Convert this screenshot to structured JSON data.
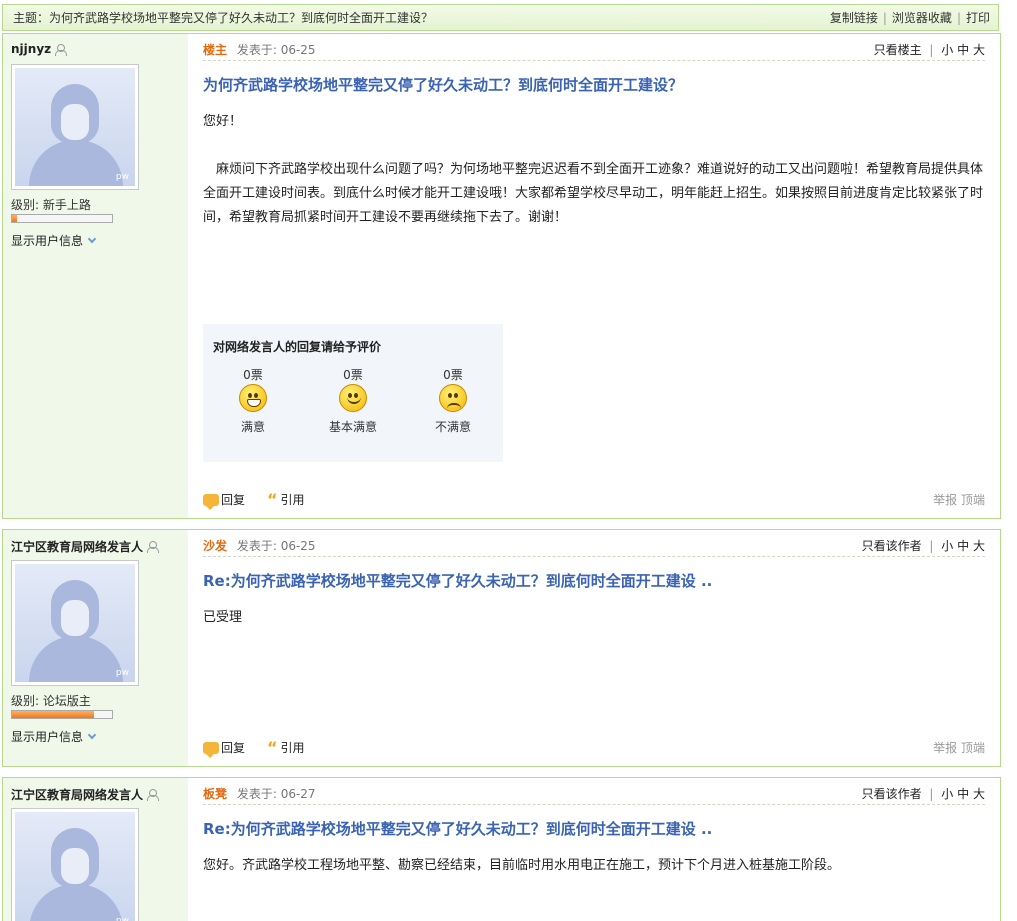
{
  "topic": {
    "title": "主题：为何齐武路学校场地平整完又停了好久未动工？到底何时全面开工建设？",
    "copy_link": "复制链接",
    "bookmark": "浏览器收藏",
    "print": "打印"
  },
  "colors": {
    "accent": "#3b63b3",
    "floor": "#e06a10",
    "border": "#b6d98f",
    "sidebar": "#f0f8e9"
  },
  "posts": [
    {
      "author": "njjnyz",
      "level": "级别: 新手上路",
      "level_progress": 0.05,
      "show_info": "显示用户信息",
      "floor": "楼主",
      "posted": "发表于: 06-25",
      "view_only": "只看楼主",
      "size_small": "小",
      "size_medium": "中",
      "size_large": "大",
      "title": "为何齐武路学校场地平整完又停了好久未动工？到底何时全面开工建设？",
      "greeting": "您好！",
      "body": "　麻烦问下齐武路学校出现什么问题了吗？为何场地平整完迟迟看不到全面开工迹象？难道说好的动工又出问题啦！希望教育局提供具体全面开工建设时间表。到底什么时候才能开工建设哦！大家都希望学校尽早动工，明年能赶上招生。如果按照目前进度肯定比较紧张了时间，希望教育局抓紧时间开工建设不要再继续拖下去了。谢谢！",
      "reply": "回复",
      "quote": "引用",
      "report": "举报",
      "top": "顶端"
    },
    {
      "author": "江宁区教育局网络发言人",
      "level": "级别: 论坛版主",
      "level_progress": 0.82,
      "show_info": "显示用户信息",
      "floor": "沙发",
      "posted": "发表于: 06-25",
      "view_only": "只看该作者",
      "size_small": "小",
      "size_medium": "中",
      "size_large": "大",
      "title": "Re:为何齐武路学校场地平整完又停了好久未动工？到底何时全面开工建设 ..",
      "body": "已受理",
      "reply": "回复",
      "quote": "引用",
      "report": "举报",
      "top": "顶端"
    },
    {
      "author": "江宁区教育局网络发言人",
      "floor": "板凳",
      "posted": "发表于: 06-27",
      "view_only": "只看该作者",
      "size_small": "小",
      "size_medium": "中",
      "size_large": "大",
      "title": "Re:为何齐武路学校场地平整完又停了好久未动工？到底何时全面开工建设 ..",
      "body": "您好。齐武路学校工程场地平整、勘察已经结束，目前临时用水用电正在施工，预计下个月进入桩基施工阶段。"
    }
  ],
  "rating": {
    "title": "对网络发言人的回复请给予评价",
    "options": [
      {
        "votes": "0票",
        "label": "满意",
        "icon": "grin-face-icon"
      },
      {
        "votes": "0票",
        "label": "基本满意",
        "icon": "smile-face-icon"
      },
      {
        "votes": "0票",
        "label": "不满意",
        "icon": "sad-face-icon"
      }
    ]
  }
}
